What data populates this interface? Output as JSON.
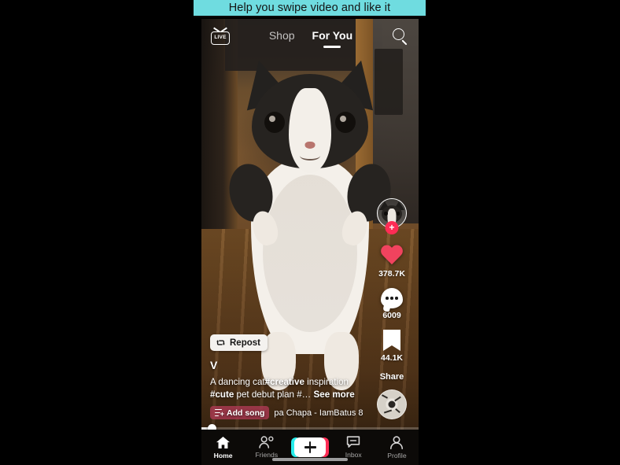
{
  "banner": {
    "text": "Help you swipe video and like it",
    "bg_color": "#6FDCE0",
    "text_color": "#141414"
  },
  "app": {
    "name": "TikTok",
    "screen": "For You feed"
  },
  "topnav": {
    "live_icon_label": "LIVE",
    "live_text": "LIVE",
    "items": [
      {
        "label": "Shop",
        "active": false
      },
      {
        "label": "For You",
        "active": true
      }
    ],
    "search_icon": "search-icon"
  },
  "rail": {
    "avatar": {
      "icon": "avatar",
      "follow_badge": "+"
    },
    "actions": [
      {
        "icon": "heart-icon",
        "count": "378.7K",
        "color": "#F1435E"
      },
      {
        "icon": "comment-icon",
        "count": "6009",
        "color": "#FFFFFF"
      },
      {
        "icon": "bookmark-icon",
        "count": "44.1K",
        "color": "#FFFFFF"
      }
    ],
    "share_label": "Share",
    "disc_icon": "music-disc-icon"
  },
  "repost": {
    "label": "Repost",
    "icon": "repost-icon"
  },
  "caption": {
    "username": "V",
    "line1_a": "A dancing cat",
    "line1_b": "#creative",
    "line1_c": " inspiration",
    "line2_a": "#cute",
    "line2_b": " pet debut plan #…",
    "see_more": "See more",
    "add_song_label": "Add song",
    "add_song_icon": "add-song-icon",
    "song_name": "pa Chapa - IamBatus 8"
  },
  "progress": {
    "percent": 5
  },
  "tabbar": {
    "items": [
      {
        "label": "Home",
        "icon": "home-icon",
        "active": true
      },
      {
        "label": "Friends",
        "icon": "friends-icon",
        "active": false
      },
      {
        "label": "Inbox",
        "icon": "inbox-icon",
        "active": false
      },
      {
        "label": "Profile",
        "icon": "profile-icon",
        "active": false
      }
    ],
    "create_icon": "plus-icon",
    "create_colors": {
      "left": "#27EDEC",
      "right": "#FE2C55"
    }
  },
  "theme": {
    "accent_pink": "#FE2C55",
    "accent_cyan": "#27EDEC"
  }
}
